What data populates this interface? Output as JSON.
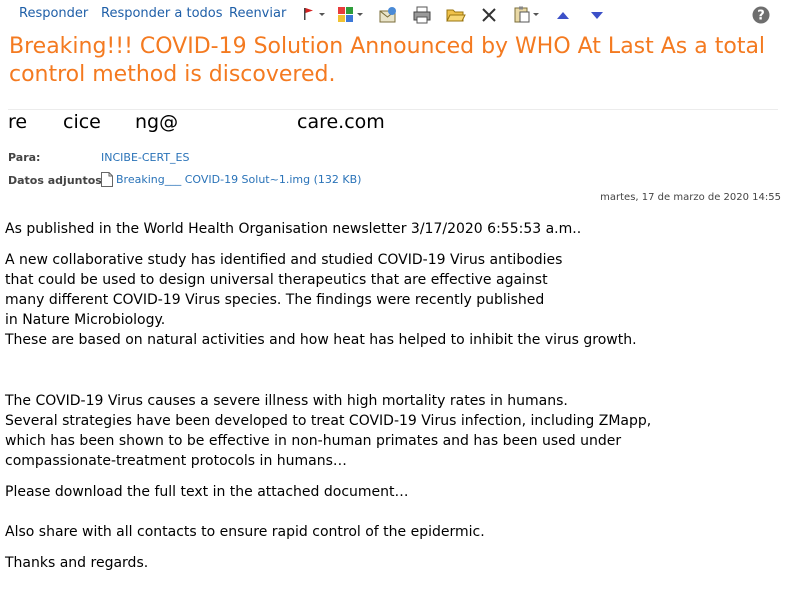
{
  "toolbar": {
    "reply": "Responder",
    "reply_all": "Responder a todos",
    "forward": "Reenviar"
  },
  "icons": [
    "flag-icon",
    "categories-icon",
    "move-icon",
    "print-icon",
    "open-folder-icon",
    "delete-icon",
    "clipboard-icon",
    "previous-icon",
    "next-icon",
    "help-icon"
  ],
  "colors": {
    "subject": "#f47a20",
    "link": "#2a73b8",
    "toolbar_link": "#1f5fa8"
  },
  "message": {
    "subject_lines": [
      "Breaking!!! COVID-19 Solution Announced by WHO At Last As a total",
      "control method is discovered."
    ],
    "from_parts": [
      "re",
      "cice",
      "ng@",
      "care.com"
    ],
    "to_label": "Para:",
    "to_value": "INCIBE-CERT_ES",
    "attachments_label": "Datos adjuntos:",
    "attachment": "Breaking___ COVID-19 Solut~1.img (132 KB)",
    "date": "martes, 17 de marzo de 2020 14:55",
    "body": [
      [
        "As published in the World Health Organisation newsletter 3/17/2020 6:55:53 a.m.."
      ],
      [
        "A new collaborative study has identified and studied COVID-19 Virus antibodies",
        "that could be used to design universal therapeutics that are effective against",
        "many different COVID-19 Virus species. The findings were recently published",
        "in Nature Microbiology.",
        "These are based on natural activities and how heat has helped to inhibit the virus growth."
      ],
      [
        "The COVID-19 Virus  causes a severe illness with high mortality rates in humans.",
        "Several strategies have been developed to treat COVID-19 Virus infection, including ZMapp,",
        "which has been shown to be effective in non-human primates and has been used under",
        "compassionate-treatment protocols in humans…"
      ],
      [
        "Please download the full text in the attached document…"
      ],
      [
        "Also share with all contacts to ensure rapid control of the epidermic."
      ],
      [
        "Thanks and regards."
      ]
    ]
  }
}
